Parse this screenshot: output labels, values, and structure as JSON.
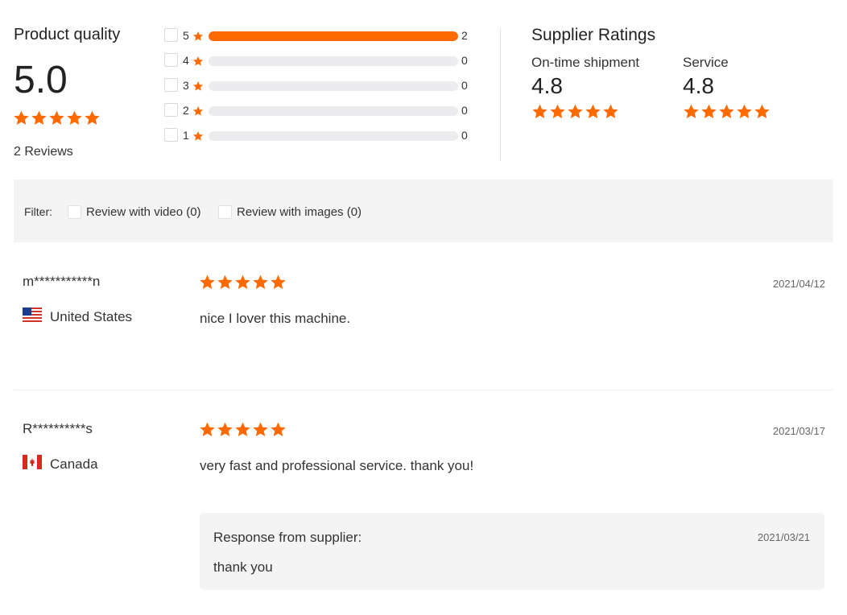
{
  "colors": {
    "accent": "#ff6a00",
    "track": "#ececee",
    "panel": "#f4f4f4"
  },
  "product_quality": {
    "title": "Product quality",
    "score": "5.0",
    "stars": 5,
    "reviews_label": "2 Reviews"
  },
  "distribution": [
    {
      "stars": "5",
      "count": "2",
      "fraction": 1.0
    },
    {
      "stars": "4",
      "count": "0",
      "fraction": 0
    },
    {
      "stars": "3",
      "count": "0",
      "fraction": 0
    },
    {
      "stars": "2",
      "count": "0",
      "fraction": 0
    },
    {
      "stars": "1",
      "count": "0",
      "fraction": 0
    }
  ],
  "supplier_ratings": {
    "title": "Supplier Ratings",
    "items": [
      {
        "label": "On-time shipment",
        "score": "4.8",
        "stars": 5
      },
      {
        "label": "Service",
        "score": "4.8",
        "stars": 5
      }
    ]
  },
  "filter": {
    "label": "Filter:",
    "options": [
      {
        "label": "Review with video (0)",
        "checked": false
      },
      {
        "label": "Review with images (0)",
        "checked": false
      }
    ]
  },
  "reviews": [
    {
      "name": "m***********n",
      "country": "United States",
      "flag_icon": "us-flag-icon",
      "stars": 5,
      "date": "2021/04/12",
      "text": "nice I lover this machine."
    },
    {
      "name": "R**********s",
      "country": "Canada",
      "flag_icon": "ca-flag-icon",
      "stars": 5,
      "date": "2021/03/17",
      "text": "very fast and professional service. thank you!",
      "response": {
        "label": "Response from supplier:",
        "date": "2021/03/21",
        "text": "thank you"
      }
    }
  ]
}
